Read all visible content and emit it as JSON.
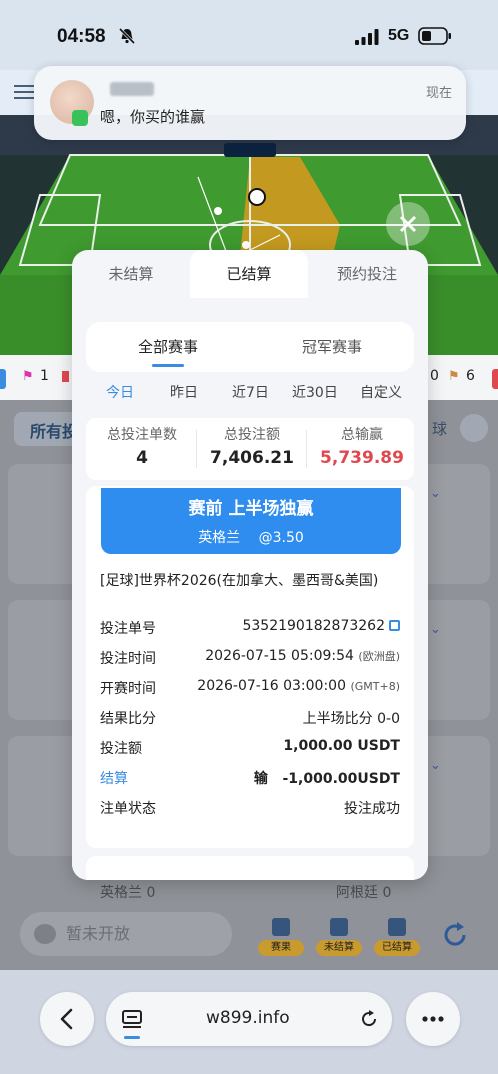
{
  "status_bar": {
    "time": "04:58",
    "network": "5G"
  },
  "notification": {
    "message": "嗯，你买的谁赢",
    "time": "现在"
  },
  "background": {
    "score_left": "1",
    "score_right": "0",
    "score_right2": "6",
    "filter_label": "所有投",
    "filter_right": "球",
    "team_left": "英格兰 0",
    "team_right": "阿根廷 0",
    "chat_placeholder": "暂未开放",
    "buttons": [
      "赛果",
      "未结算",
      "已结算"
    ]
  },
  "modal": {
    "tabs": [
      "未结算",
      "已结算",
      "预约投注"
    ],
    "active_tab": 1,
    "subtabs": [
      "全部赛事",
      "冠军赛事"
    ],
    "date_filters": [
      "今日",
      "昨日",
      "近7日",
      "近30日",
      "自定义"
    ],
    "stats": [
      {
        "label": "总投注单数",
        "value": "4"
      },
      {
        "label": "总投注额",
        "value": "7,406.21"
      },
      {
        "label": "总输赢",
        "value": "5,739.89"
      }
    ],
    "bet": {
      "market": "赛前 上半场独赢",
      "selection": "英格兰",
      "odds": "@3.50",
      "league": "[足球]世界杯2026(在加拿大、墨西哥&美国)",
      "rows": [
        {
          "key": "投注单号",
          "value": "5352190182873262",
          "extra": ""
        },
        {
          "key": "投注时间",
          "value": "2026-07-15 05:09:54",
          "extra": "(欧洲盘)"
        },
        {
          "key": "开赛时间",
          "value": "2026-07-16 03:00:00",
          "extra": "(GMT+8)"
        },
        {
          "key": "结果比分",
          "value": "上半场比分 0-0",
          "extra": ""
        },
        {
          "key": "投注额",
          "value": "1,000.00 USDT",
          "extra": ""
        },
        {
          "key": "结算",
          "value": "-1,000.00USDT",
          "extra": "输"
        },
        {
          "key": "注单状态",
          "value": "投注成功",
          "extra": ""
        }
      ]
    }
  },
  "browser": {
    "url": "w899.info"
  }
}
